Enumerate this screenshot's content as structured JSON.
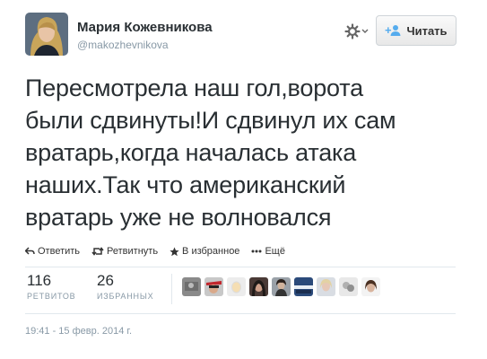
{
  "user": {
    "name": "Мария Кожевникова",
    "handle": "@makozhevnikova"
  },
  "follow_button": {
    "label": "Читать",
    "icon": "add-user-icon"
  },
  "settings_icon": "gear-icon",
  "tweet": {
    "lines": [
      "Пересмотрела наш гол,ворота",
      "были сдвинуты!И сдвинул их сам",
      "вратарь,когда началась атака",
      "наших.Так что американский",
      "вратарь уже не волновался"
    ]
  },
  "actions": [
    {
      "icon": "reply-icon",
      "label": "Ответить"
    },
    {
      "icon": "retweet-icon",
      "label": "Ретвитнуть"
    },
    {
      "icon": "star-icon",
      "label": "В избранное"
    },
    {
      "icon": "more-icon",
      "label": "Ещё"
    }
  ],
  "stats": {
    "retweets": {
      "value": "116",
      "label": "РЕТВИТОВ"
    },
    "favorites": {
      "value": "26",
      "label": "ИЗБРАННЫХ"
    }
  },
  "favoriters_count": 9,
  "timestamp": "19:41 - 15 февр. 2014 г.",
  "colors": {
    "text": "#292f33",
    "secondary": "#8899a6",
    "divider": "#e1e8ed",
    "follow_plus": "#55acee"
  }
}
